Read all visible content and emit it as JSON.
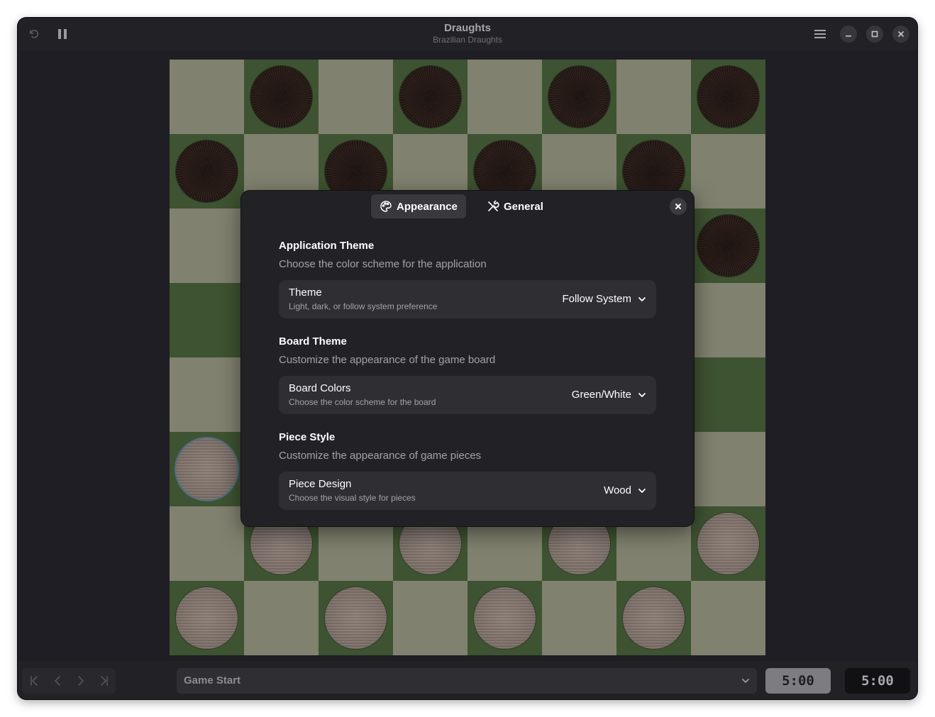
{
  "window": {
    "title": "Draughts",
    "subtitle": "Brazilian Draughts"
  },
  "headerbar": {
    "undo_icon": "undo-icon",
    "pause_icon": "pause-icon",
    "menu_icon": "hamburger-menu-icon",
    "minimize_icon": "minimize-icon",
    "maximize_icon": "maximize-icon",
    "close_icon": "close-icon"
  },
  "colors": {
    "board_light": "#81816f",
    "board_dark": "#3e5331",
    "window_bg": "#1e1e24",
    "dialog_bg": "#222226",
    "row_bg": "#2e2e33"
  },
  "board": {
    "rows": [
      [
        "",
        "dark",
        "",
        "dark",
        "",
        "dark",
        "",
        "dark"
      ],
      [
        "dark",
        "",
        "dark",
        "",
        "dark",
        "",
        "dark",
        ""
      ],
      [
        "",
        "",
        "",
        "",
        "",
        "",
        "",
        "dark"
      ],
      [
        "",
        "",
        "",
        "",
        "",
        "",
        "",
        ""
      ],
      [
        "",
        "",
        "",
        "",
        "",
        "",
        "",
        ""
      ],
      [
        "light-selected",
        "",
        "",
        "",
        "",
        "",
        "",
        ""
      ],
      [
        "",
        "light",
        "",
        "light",
        "",
        "light",
        "",
        "light"
      ],
      [
        "light",
        "",
        "light",
        "",
        "light",
        "",
        "light",
        ""
      ]
    ]
  },
  "preferences": {
    "tabs": [
      {
        "label": "Appearance",
        "icon": "palette-icon",
        "selected": true
      },
      {
        "label": "General",
        "icon": "tools-icon",
        "selected": false
      }
    ],
    "close_icon": "close-icon",
    "sections": [
      {
        "title": "Application Theme",
        "description": "Choose the color scheme for the application",
        "row": {
          "title": "Theme",
          "subtitle": "Light, dark, or follow system preference",
          "value": "Follow System"
        }
      },
      {
        "title": "Board Theme",
        "description": "Customize the appearance of the game board",
        "row": {
          "title": "Board Colors",
          "subtitle": "Choose the color scheme for the board",
          "value": "Green/White"
        }
      },
      {
        "title": "Piece Style",
        "description": "Customize the appearance of game pieces",
        "row": {
          "title": "Piece Design",
          "subtitle": "Choose the visual style for pieces",
          "value": "Wood"
        }
      }
    ]
  },
  "bottombar": {
    "nav_icons": [
      "go-first-icon",
      "go-previous-icon",
      "go-next-icon",
      "go-last-icon"
    ],
    "move_history": "Game Start",
    "clock_left": "5:00",
    "clock_right": "5:00"
  }
}
